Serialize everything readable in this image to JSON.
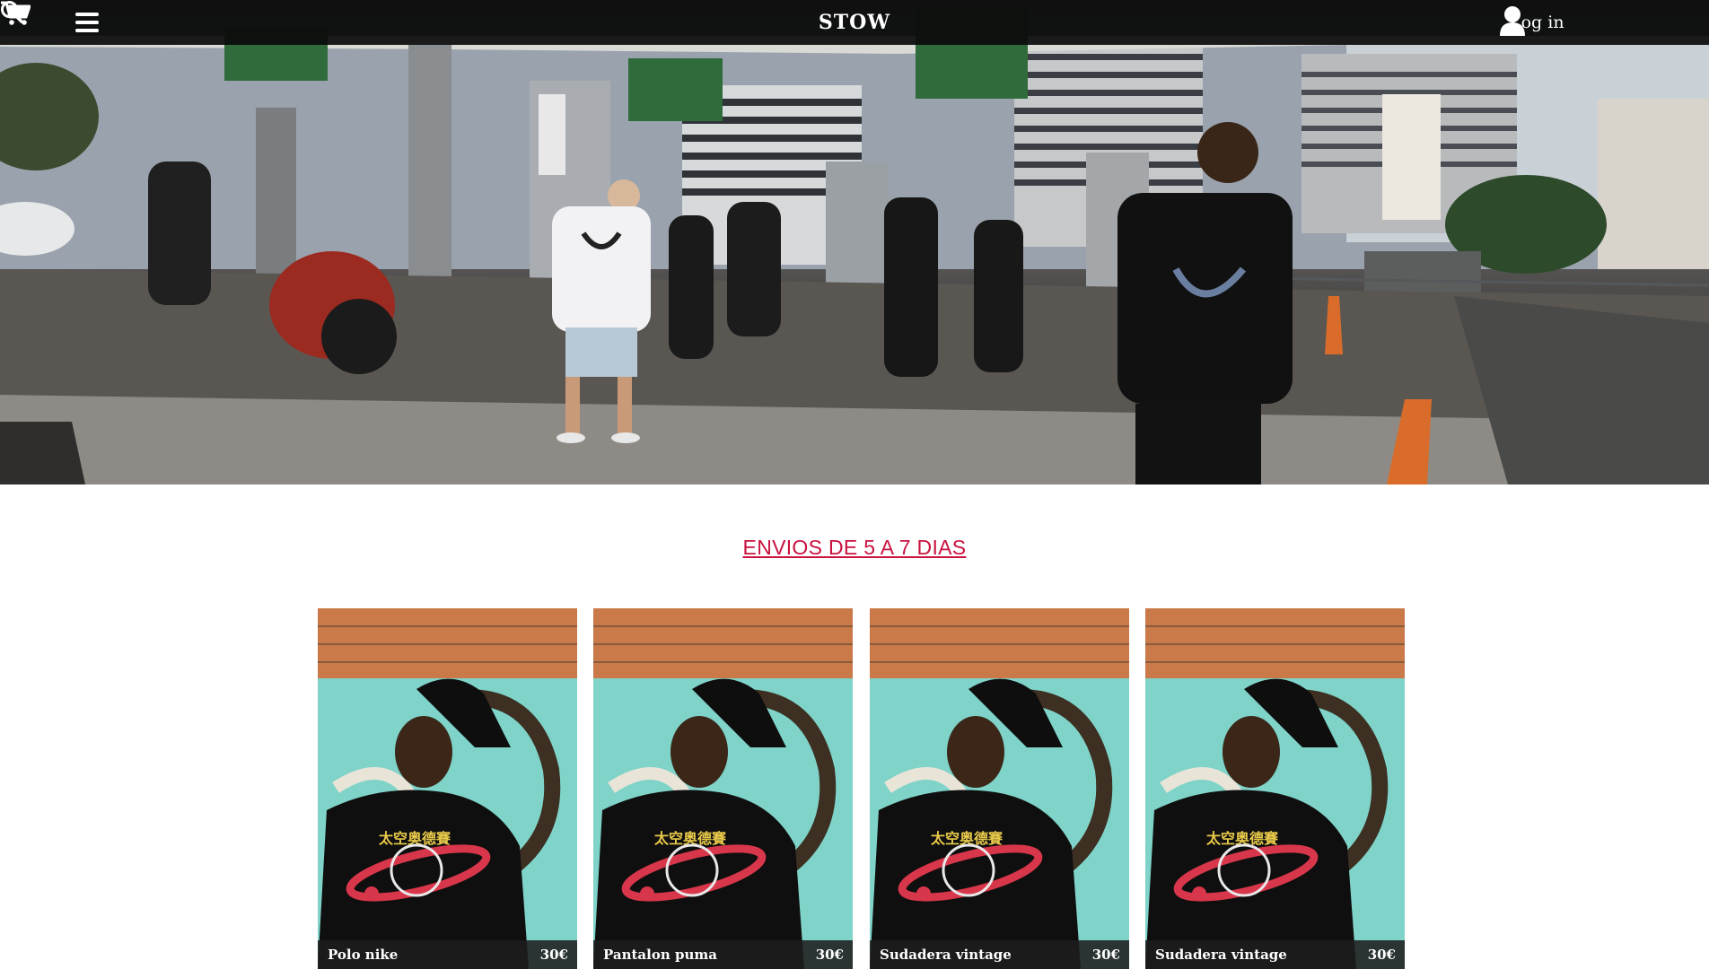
{
  "header": {
    "brand": "STOW",
    "login_label": "Log in",
    "icons": {
      "menu": "hamburger-menu-icon",
      "account": "user-icon",
      "search": "search-icon",
      "cart": "cart-icon"
    }
  },
  "announcement": {
    "text": "ENVIOS DE 5 A 7 DIAS",
    "color": "#c9123f"
  },
  "products": [
    {
      "name": "Polo nike",
      "price": "30€"
    },
    {
      "name": "Pantalon puma",
      "price": "30€"
    },
    {
      "name": "Sudadera vintage",
      "price": "30€"
    },
    {
      "name": "Sudadera vintage",
      "price": "30€"
    }
  ]
}
